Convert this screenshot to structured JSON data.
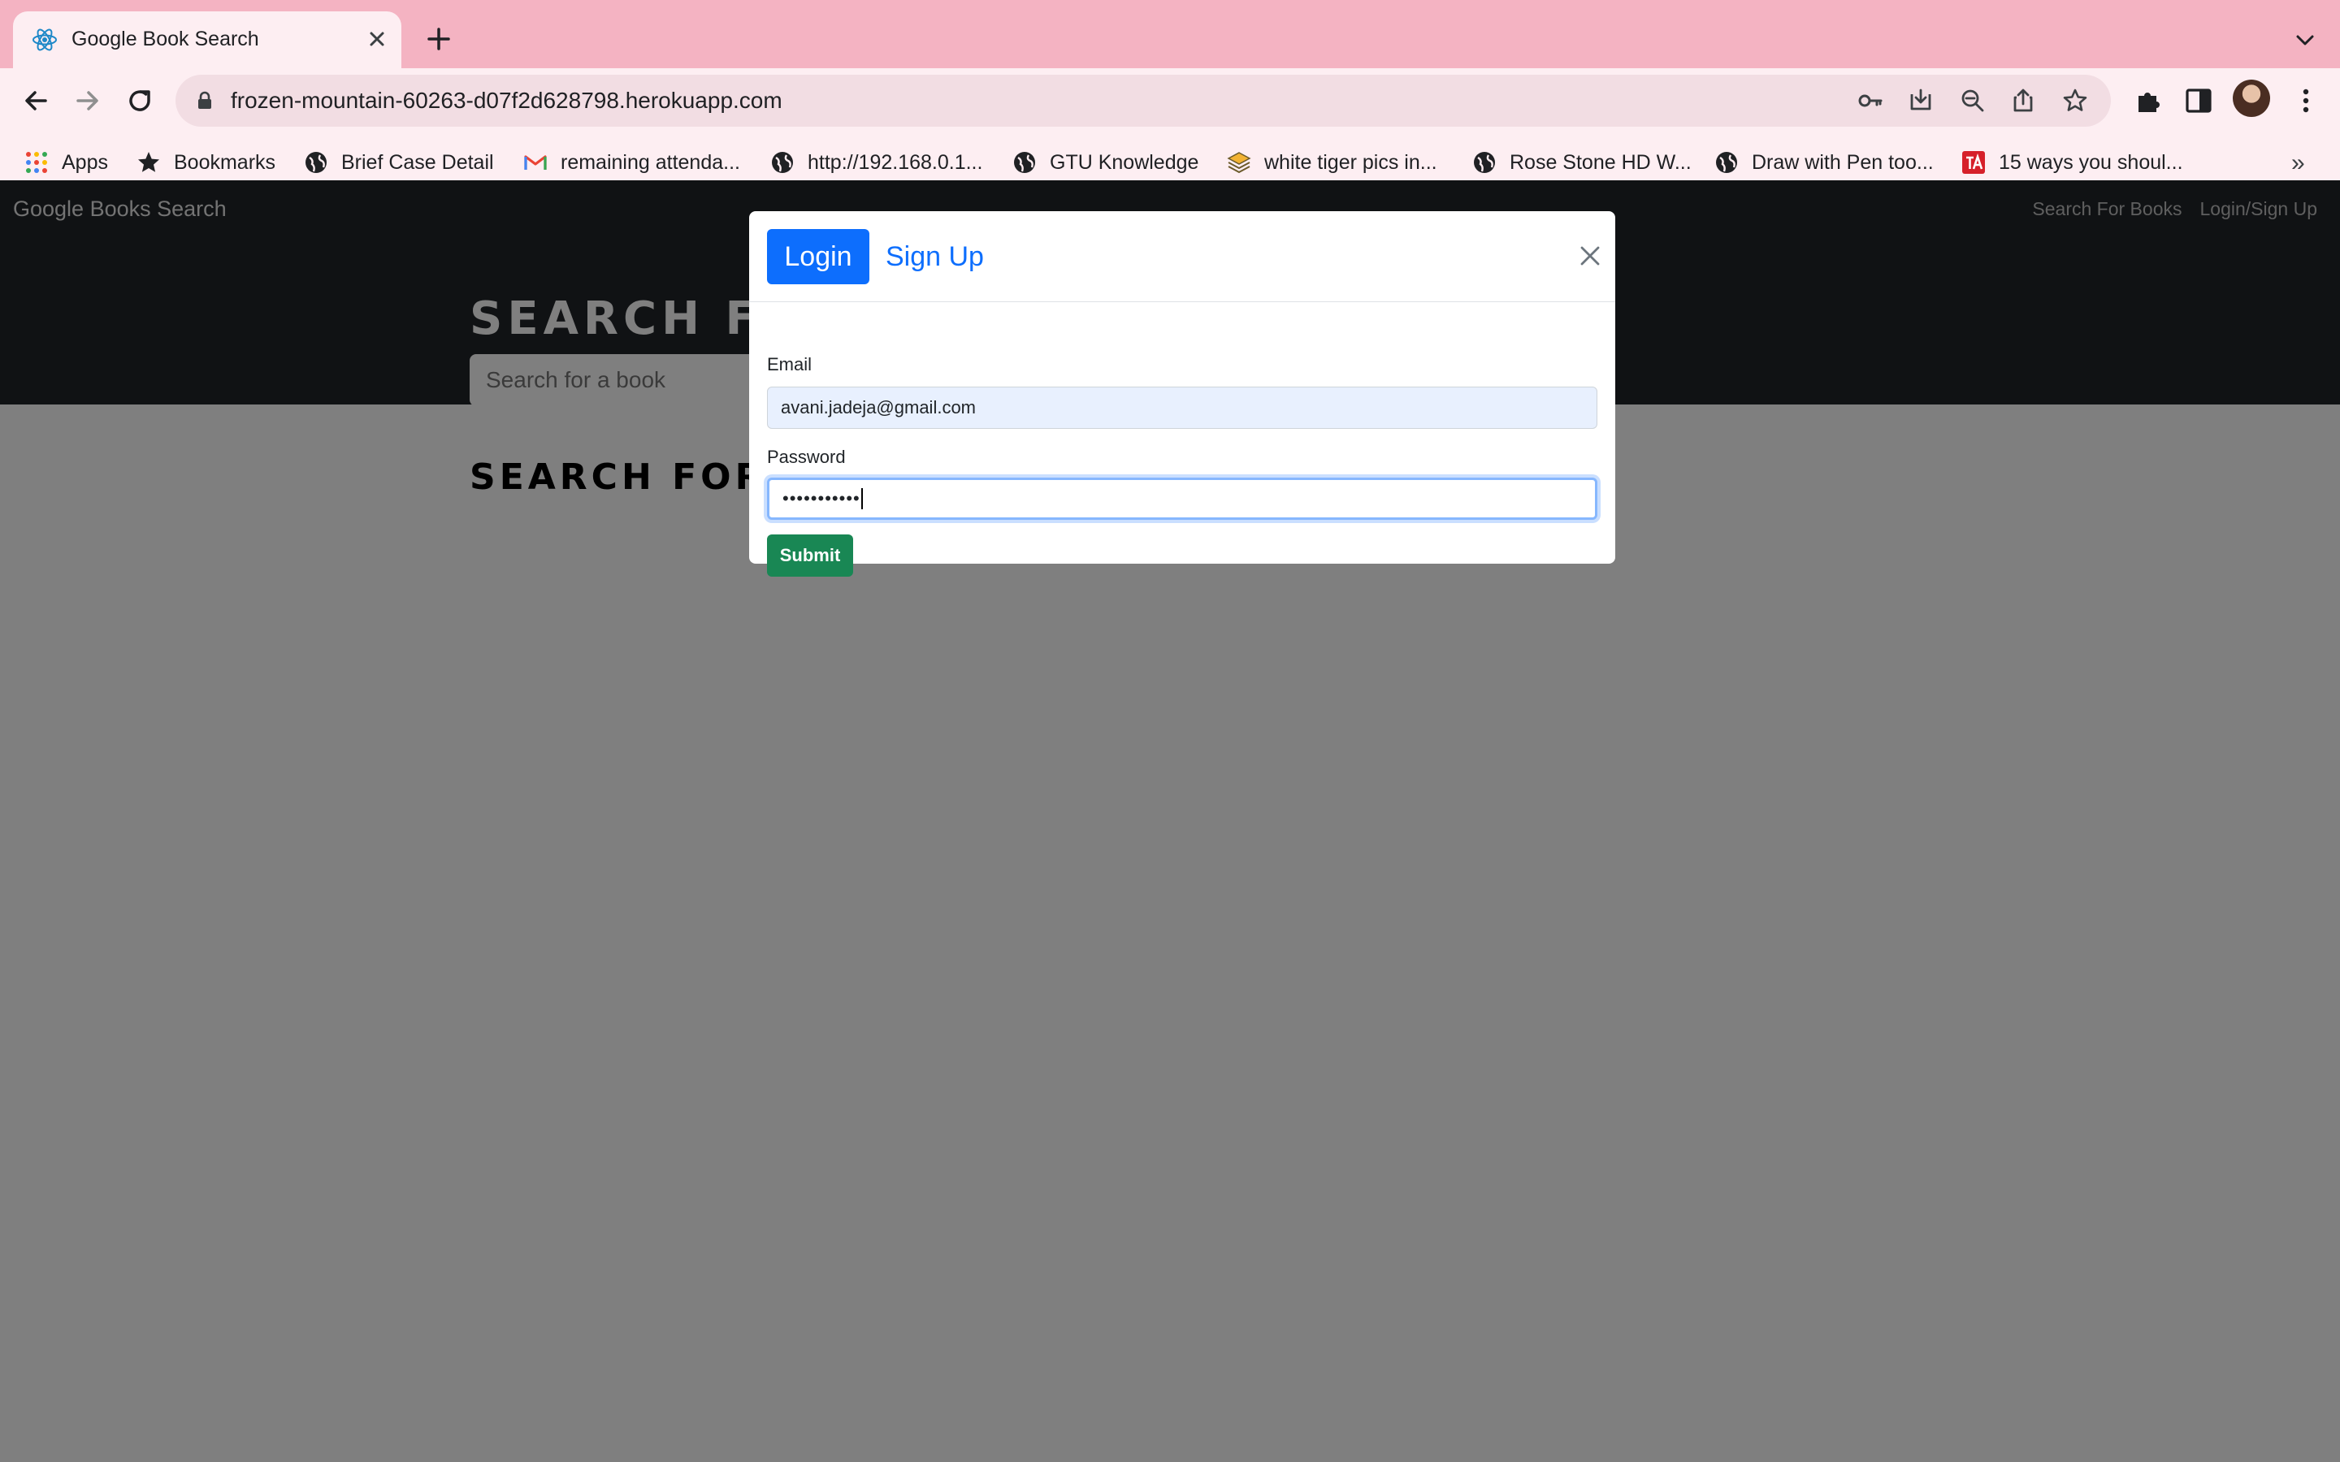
{
  "browser": {
    "tab": {
      "title": "Google Book Search",
      "favicon": "react-logo-icon"
    },
    "address_bar": {
      "url": "frozen-mountain-60263-d07f2d628798.herokuapp.com"
    },
    "bookmarks": [
      {
        "label": "Apps",
        "icon": "apps-grid-icon"
      },
      {
        "label": "Bookmarks",
        "icon": "star-icon"
      },
      {
        "label": "Brief Case Detail",
        "icon": "globe-icon"
      },
      {
        "label": "remaining attenda...",
        "icon": "gmail-icon"
      },
      {
        "label": "http://192.168.0.1...",
        "icon": "globe-icon"
      },
      {
        "label": "GTU Knowledge",
        "icon": "globe-icon"
      },
      {
        "label": "white tiger pics in...",
        "icon": "layers-icon"
      },
      {
        "label": "Rose Stone HD W...",
        "icon": "globe-icon"
      },
      {
        "label": "Draw with Pen too...",
        "icon": "globe-icon"
      },
      {
        "label": "15 ways you shoul...",
        "icon": "ta-logo-icon"
      }
    ],
    "bookmarks_overflow": "»",
    "colors": {
      "tabstrip": "#f4b3c2",
      "toolbar": "#fdeef2"
    }
  },
  "page": {
    "navbar": {
      "brand": "Google Books Search",
      "links": [
        "Search For Books",
        "Login/Sign Up"
      ]
    },
    "hero": {
      "title": "SEARCH F",
      "search_placeholder": "Search for a book"
    },
    "results_title": "SEARCH FOR"
  },
  "modal": {
    "tabs": {
      "login": "Login",
      "signup": "Sign Up"
    },
    "email": {
      "label": "Email",
      "value": "avani.jadeja@gmail.com"
    },
    "password": {
      "label": "Password",
      "value": "•••••••••••"
    },
    "submit_label": "Submit",
    "colors": {
      "primary": "#0d6efd",
      "success": "#198754",
      "focus_ring": "#86b7fe"
    }
  }
}
